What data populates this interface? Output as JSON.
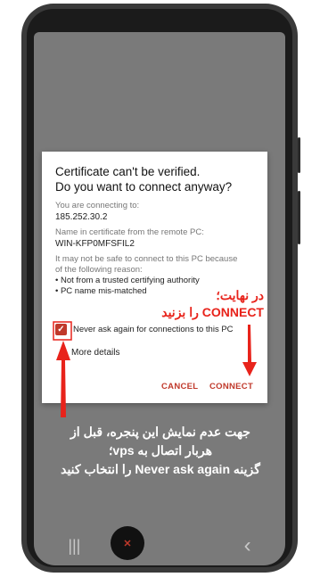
{
  "dialog": {
    "title_line1": "Certificate can't be verified.",
    "title_line2": "Do you want to connect anyway?",
    "connecting_label": "You are connecting to:",
    "connecting_value": "185.252.30.2",
    "cert_name_label": "Name in certificate from the remote PC:",
    "cert_name_value": "WIN-KFP0MFSFIL2",
    "warning_line1": "It may not be safe to connect to this PC because",
    "warning_line2": "of the following reason:",
    "reason1": "• Not from a trusted certifying authority",
    "reason2": "• PC name mis-matched",
    "checkbox_label": "Never ask again for connections to this PC",
    "checkbox_checked": true,
    "more_details": "More details",
    "cancel": "CANCEL",
    "connect": "CONNECT"
  },
  "annotations": {
    "red_line1": "در نهایت؛",
    "red_line2": "CONNECT را بزنید",
    "white_line1": "جهت عدم نمایش این پنجره، قبل از",
    "white_line2": "هربار اتصال به vps؛",
    "white_line3": "گزینه Never ask again را انتخاب کنید"
  },
  "navbar": {
    "recent_icon": "|||",
    "back_icon": "‹"
  },
  "colors": {
    "accent": "#c0392b",
    "annotation_red": "#e8231b"
  }
}
